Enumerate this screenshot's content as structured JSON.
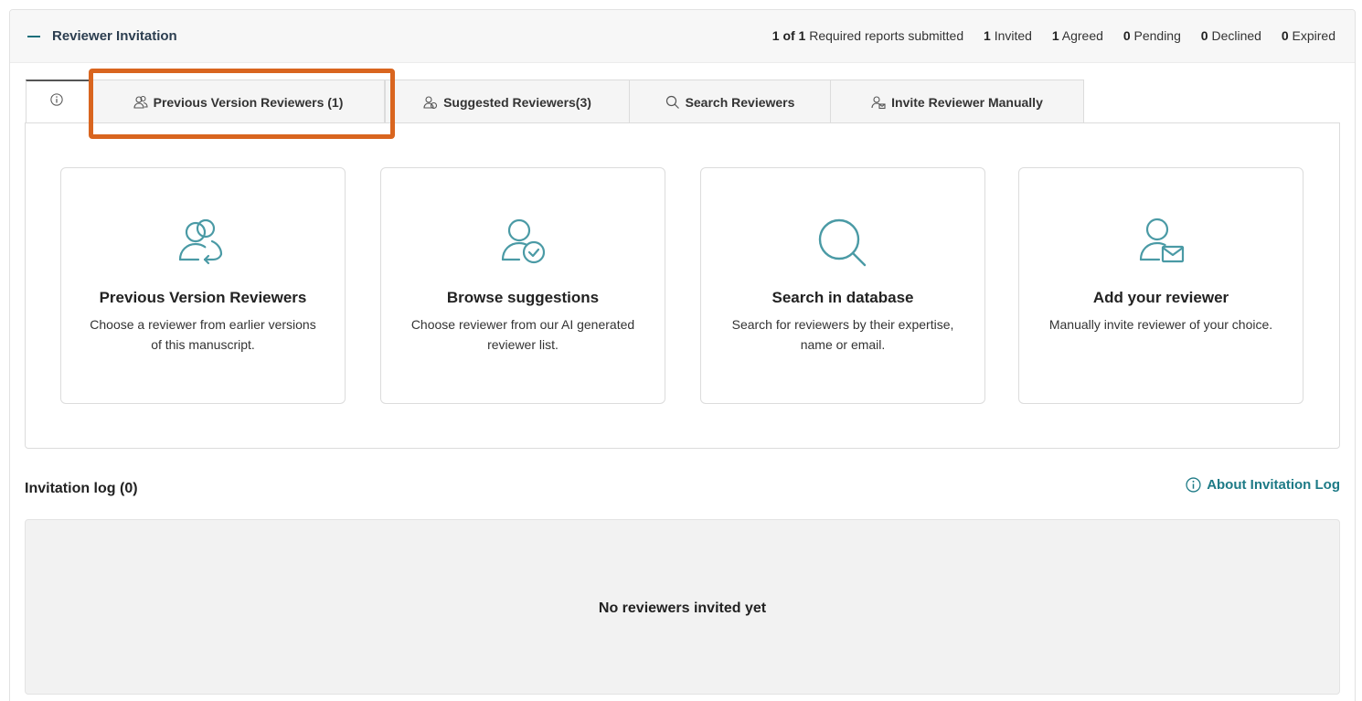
{
  "header": {
    "title": "Reviewer Invitation",
    "stats": {
      "required_value": "1 of 1",
      "required_label": "Required reports submitted",
      "invited_value": "1",
      "invited_label": "Invited",
      "agreed_value": "1",
      "agreed_label": "Agreed",
      "pending_value": "0",
      "pending_label": "Pending",
      "declined_value": "0",
      "declined_label": "Declined",
      "expired_value": "0",
      "expired_label": "Expired"
    }
  },
  "tabs": [
    {
      "label": "",
      "icon": "info-icon"
    },
    {
      "label": "Previous Version Reviewers (1)",
      "icon": "users-icon"
    },
    {
      "label": "Suggested Reviewers(3)",
      "icon": "users-icon"
    },
    {
      "label": "Search Reviewers",
      "icon": "search-icon"
    },
    {
      "label": "Invite Reviewer Manually",
      "icon": "user-mail-icon"
    }
  ],
  "cards": [
    {
      "title": "Previous Version Reviewers",
      "description": "Choose a reviewer from earlier versions of this manuscript.",
      "icon": "users-return-icon"
    },
    {
      "title": "Browse suggestions",
      "description": "Choose reviewer from our AI generated reviewer list.",
      "icon": "user-check-icon"
    },
    {
      "title": "Search in database",
      "description": "Search for reviewers by their expertise, name or email.",
      "icon": "search-icon"
    },
    {
      "title": "Add your reviewer",
      "description": "Manually invite reviewer of your choice.",
      "icon": "user-mail-icon"
    }
  ],
  "log": {
    "title": "Invitation log (0)",
    "about_label": "About Invitation Log",
    "empty_message": "No reviewers invited yet"
  },
  "colors": {
    "accent": "#1d7a86",
    "highlight": "#d9651f",
    "icon": "#4a9aa5"
  }
}
